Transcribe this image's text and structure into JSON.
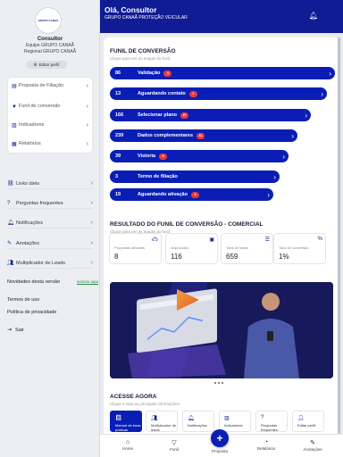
{
  "sidebar": {
    "logo_text": "GRUPO CANAÃ",
    "role": "Consultor",
    "team": "Equipe GRUPO CANAÃ",
    "regional": "Regional GRUPO CANAÃ",
    "edit_label": "Editar perfil",
    "menu": [
      {
        "label": "Proposta de Filiação",
        "icon": "document-icon"
      },
      {
        "label": "Funil de conversão",
        "icon": "funnel-icon"
      },
      {
        "label": "Indicadores",
        "icon": "chart-icon"
      },
      {
        "label": "Relatórios",
        "icon": "report-icon"
      }
    ],
    "links": [
      {
        "label": "Links úteis",
        "icon": "link-icon"
      },
      {
        "label": "Perguntas frequentes",
        "icon": "question-icon"
      },
      {
        "label": "Notificações",
        "icon": "bell-icon"
      },
      {
        "label": "Anotações",
        "icon": "note-icon"
      },
      {
        "label": "Multiplicador de Leads",
        "icon": "people-icon"
      }
    ],
    "news_label": "Novidades desta versão",
    "news_link": "acesse aqui",
    "terms": "Termos de uso",
    "privacy": "Política de privacidade",
    "exit": "Sair"
  },
  "header": {
    "greeting": "Olá, Consultor",
    "subtitle": "GRUPO CANAÃ PROTEÇÃO VEICULAR"
  },
  "funnel": {
    "title": "FUNIL DE CONVERSÃO",
    "subtitle": "Clique para ver as etapas do funil",
    "steps": [
      {
        "value": "86",
        "label": "Validação",
        "badge": "4"
      },
      {
        "value": "13",
        "label": "Aguardando contato",
        "badge": "1"
      },
      {
        "value": "166",
        "label": "Selecionar plano",
        "badge": "37"
      },
      {
        "value": "239",
        "label": "Dados complementares",
        "badge": "34"
      },
      {
        "value": "39",
        "label": "Vistoria",
        "badge": "9"
      },
      {
        "value": "3",
        "label": "Termo de filiação",
        "badge": ""
      },
      {
        "value": "19",
        "label": "Aguardando ativação",
        "badge": "4"
      }
    ]
  },
  "results": {
    "title": "RESULTADO DO FUNIL DE CONVERSÃO - COMERCIAL",
    "subtitle": "Clique para ver as etapas do funil",
    "stats": [
      {
        "label": "Propostas ativadas",
        "value": "8",
        "icon": "car-icon"
      },
      {
        "label": "Arquivados",
        "value": "116",
        "icon": "archive-icon"
      },
      {
        "label": "Total de leads",
        "value": "659",
        "icon": "list-icon"
      },
      {
        "label": "Taxa de conversão",
        "value": "1%",
        "icon": "percent-icon"
      }
    ]
  },
  "quick_access": {
    "title": "ACESSE AGORA",
    "subtitle": "Clique e veja as principais informações",
    "items": [
      {
        "label": "Manual de boas práticas",
        "icon": "book-icon"
      },
      {
        "label": "Multiplicador de leads",
        "icon": "people-icon"
      },
      {
        "label": "Notificações",
        "icon": "bell-icon"
      },
      {
        "label": "Indicadores",
        "icon": "chart-icon"
      },
      {
        "label": "Perguntas frequentes",
        "icon": "question-icon"
      },
      {
        "label": "Editar perfil",
        "icon": "user-icon"
      }
    ]
  },
  "bottom_nav": {
    "home": "Home",
    "funnel": "Funil",
    "proposal": "Proposta",
    "reports": "Relatórios",
    "notes": "Anotações"
  }
}
